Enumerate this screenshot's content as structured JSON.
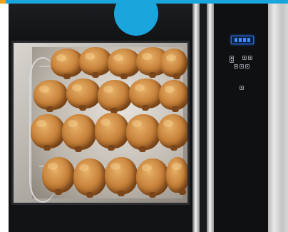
{
  "image": {
    "subject": "rotisserie-oven",
    "oven": {
      "window": {
        "content": "roast-chickens"
      },
      "control_panel": {
        "display": "lcd-display",
        "buttons": [
          "control-button",
          "control-button",
          "control-button",
          "control-button",
          "control-button",
          "control-button",
          "control-button",
          "control-button"
        ]
      }
    },
    "colors": {
      "badge": "#1aa6dc",
      "oven_black": "#121315",
      "stainless_steel": "#c8c8c8",
      "lcd": "#3d8cff",
      "chicken_golden": "#c9843c"
    }
  }
}
